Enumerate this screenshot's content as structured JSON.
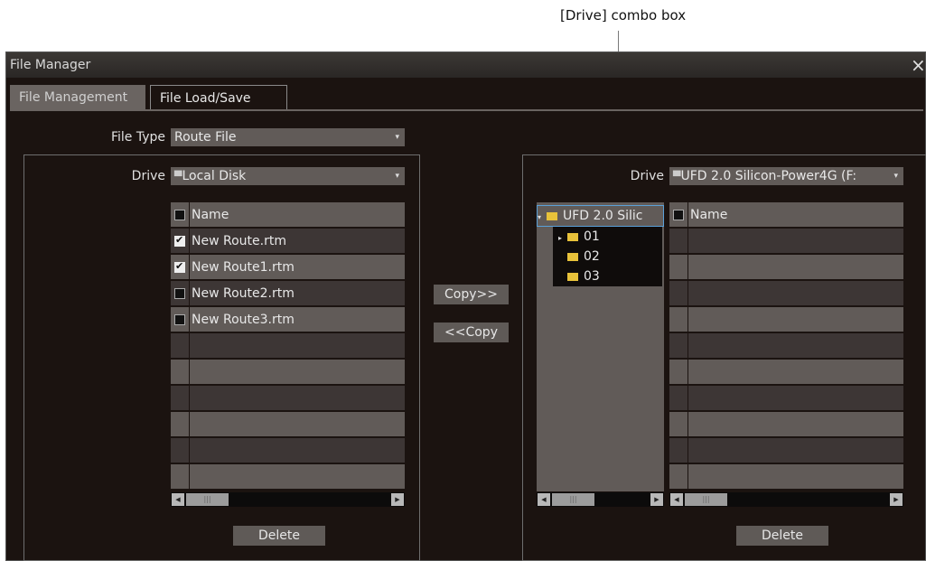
{
  "callout": {
    "label": "[Drive] combo box"
  },
  "window": {
    "title": "File Manager",
    "close_icon": "×"
  },
  "tabs": [
    {
      "label": "File Management",
      "active": true
    },
    {
      "label": "File Load/Save",
      "active": false
    }
  ],
  "file_type": {
    "label": "File Type",
    "value": "Route File"
  },
  "left_panel": {
    "drive_label": "Drive",
    "drive_value": "Local Disk",
    "header": "Name",
    "files": [
      {
        "name": "New Route.rtm",
        "checked": true
      },
      {
        "name": "New Route1.rtm",
        "checked": true
      },
      {
        "name": "New Route2.rtm",
        "checked": false
      },
      {
        "name": "New Route3.rtm",
        "checked": false
      }
    ],
    "delete_label": "Delete"
  },
  "copy_right_label": "Copy>>",
  "copy_left_label": "<<Copy",
  "right_panel": {
    "drive_label": "Drive",
    "drive_value": "UFD 2.0 Silicon-Power4G (F:",
    "tree_root": "UFD 2.0 Silic",
    "tree_items": [
      "01",
      "02",
      "03"
    ],
    "header": "Name",
    "delete_label": "Delete"
  },
  "colors": {
    "window_bg": "#1b1310",
    "control_bg": "#615b58",
    "folder": "#e8c23a"
  }
}
